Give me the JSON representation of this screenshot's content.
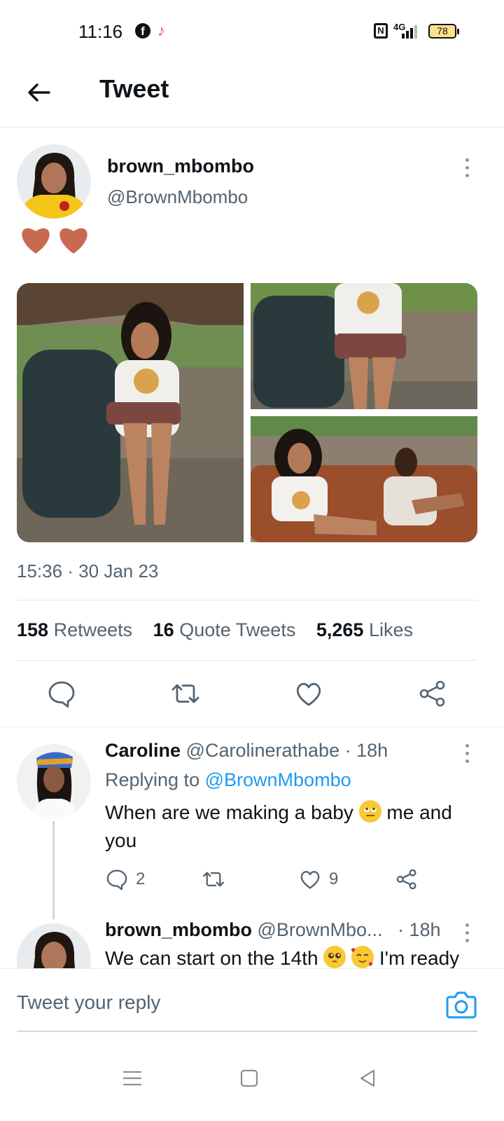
{
  "status_bar": {
    "time": "11:16",
    "network": "4G",
    "battery": "78",
    "icons": [
      "facebook-icon",
      "tiktok-icon",
      "nfc-icon",
      "signal-icon",
      "battery-icon"
    ]
  },
  "header": {
    "title": "Tweet",
    "back_icon": "arrow-left-icon"
  },
  "tweet": {
    "author_name": "brown_mbombo",
    "author_handle": "@BrownMbombo",
    "hearts_emoji": "❤❤",
    "photo_count": 3,
    "timestamp": "15:36 · 30 Jan 23",
    "stats": {
      "retweets_count": "158",
      "retweets_label": "Retweets",
      "quotes_count": "16",
      "quotes_label": "Quote Tweets",
      "likes_count": "5,265",
      "likes_label": "Likes"
    },
    "actions": [
      "reply-icon",
      "retweet-icon",
      "like-icon",
      "share-icon"
    ]
  },
  "replies": [
    {
      "name": "Caroline",
      "handle": "@Carolinerathabe",
      "time": "· 18h",
      "replying_label": "Replying to",
      "replying_to": "@BrownMbombo",
      "text_before_emoji": "When are we making a baby",
      "emoji": "🙄",
      "text_after_emoji": "me and you",
      "reply_count": "2",
      "retweet_count": "",
      "like_count": "9"
    },
    {
      "name": "brown_mbombo",
      "handle": "@BrownMbo...",
      "time": "· 18h",
      "text": "We can start on the 14th",
      "emojis": "🥺🥰",
      "text_after": "I'm ready"
    }
  ],
  "compose": {
    "placeholder": "Tweet your reply",
    "camera_icon": "camera-icon"
  },
  "nav_bar": {
    "icons": [
      "menu-icon",
      "home-square-icon",
      "back-triangle-icon"
    ]
  },
  "colors": {
    "accent": "#1d9bf0",
    "secondary_text": "#536471",
    "divider": "#e1e8ed",
    "heart": "#c9694f"
  }
}
